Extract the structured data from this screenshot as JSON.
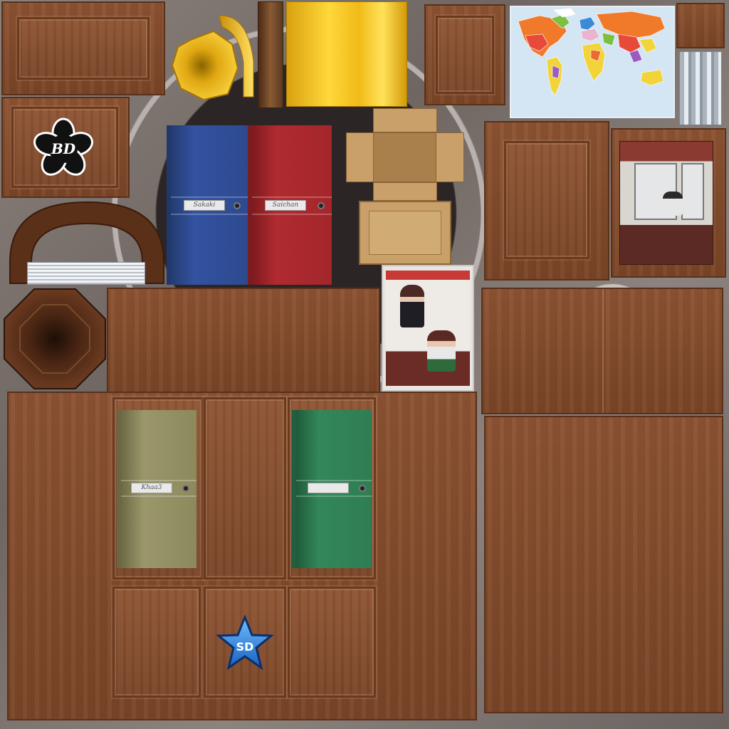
{
  "emblems": {
    "logo_bd": "BD",
    "logo_sd": "SD"
  },
  "binders": {
    "blue_label": "Sakaki",
    "red_label": "Saichan",
    "olive_label": "Khaa3",
    "green_label": ""
  },
  "colors": {
    "wood": "#8c5332",
    "blue_binder": "#2f4b8a",
    "red_binder": "#a8262b",
    "olive_binder": "#8c8a5c",
    "green_binder": "#2f7d54",
    "gold": "#e8b820",
    "cardboard": "#c8a366"
  },
  "icons": {
    "logo": "sakura-flower-icon",
    "star": "star-icon",
    "map": "world-map-icon"
  }
}
